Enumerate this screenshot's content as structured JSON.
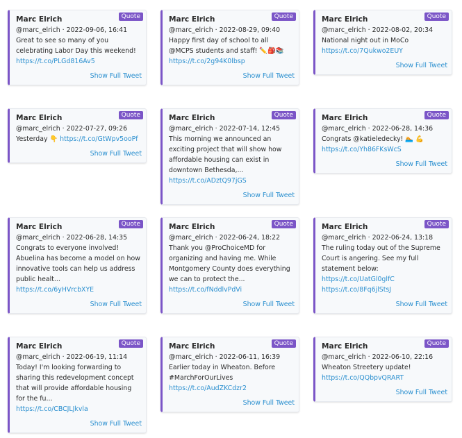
{
  "badge_label": "Quote",
  "show_full_label": "Show Full Tweet",
  "cards": [
    {
      "name": "Marc Elrich",
      "meta": "@marc_elrich · 2022-09-06, 16:41",
      "text": "Great to see so many of you celebrating Labor Day this weekend!",
      "link": "https://t.co/PLGd816Av5"
    },
    {
      "name": "Marc Elrich",
      "meta": "@marc_elrich · 2022-08-29, 09:40",
      "text": "Happy first day of school to all @MCPS students and staff! ✏️🎒📚",
      "link": "https://t.co/2g94K0lbsp"
    },
    {
      "name": "Marc Elrich",
      "meta": "@marc_elrich · 2022-08-02, 20:34",
      "text": "National night out in MoCo",
      "link": "https://t.co/7Qukwo2EUY"
    },
    {
      "name": "Marc Elrich",
      "meta": "@marc_elrich · 2022-07-27, 09:26",
      "text": "Yesterday 👇",
      "link": "https://t.co/GtWpv5ooPf"
    },
    {
      "name": "Marc Elrich",
      "meta": "@marc_elrich · 2022-07-14, 12:45",
      "text": "This morning we announced an exciting project that will show how affordable housing can exist in downtown Bethesda,...",
      "link": "https://t.co/ADztQ97jGS"
    },
    {
      "name": "Marc Elrich",
      "meta": "@marc_elrich · 2022-06-28, 14:36",
      "text": "Congrats @katieledecky! 🏊 💪",
      "link": "https://t.co/Yh86FKsWcS"
    },
    {
      "name": "Marc Elrich",
      "meta": "@marc_elrich · 2022-06-28, 14:35",
      "text": "Congrats to everyone involved! Abuelina has become a model on how innovative tools can help us address public healt...",
      "link": "https://t.co/6yHVrcbXYE"
    },
    {
      "name": "Marc Elrich",
      "meta": "@marc_elrich · 2022-06-24, 18:22",
      "text": "Thank you @ProChoiceMD for organizing and having me. While Montgomery County does everything we can to protect the...",
      "link": "https://t.co/fNddlvPdVi"
    },
    {
      "name": "Marc Elrich",
      "meta": "@marc_elrich · 2022-06-24, 13:18",
      "text": "The ruling today out of the Supreme Court is angering. See my full statement below:",
      "link": "https://t.co/UatGl0glfC https://t.co/8Fq6jlStsJ"
    },
    {
      "name": "Marc Elrich",
      "meta": "@marc_elrich · 2022-06-19, 11:14",
      "text": "Today! I'm looking forwarding to sharing this redevelopment concept that will provide affordable housing for the fu...",
      "link": "https://t.co/CBCJLJkvla"
    },
    {
      "name": "Marc Elrich",
      "meta": "@marc_elrich · 2022-06-11, 16:39",
      "text": "Earlier today in Wheaton. Before #MarchForOurLives",
      "link": "https://t.co/AudZKCdzr2"
    },
    {
      "name": "Marc Elrich",
      "meta": "@marc_elrich · 2022-06-10, 22:16",
      "text": "Wheaton Streetery update!",
      "link": "https://t.co/QQbpvQRART"
    }
  ]
}
